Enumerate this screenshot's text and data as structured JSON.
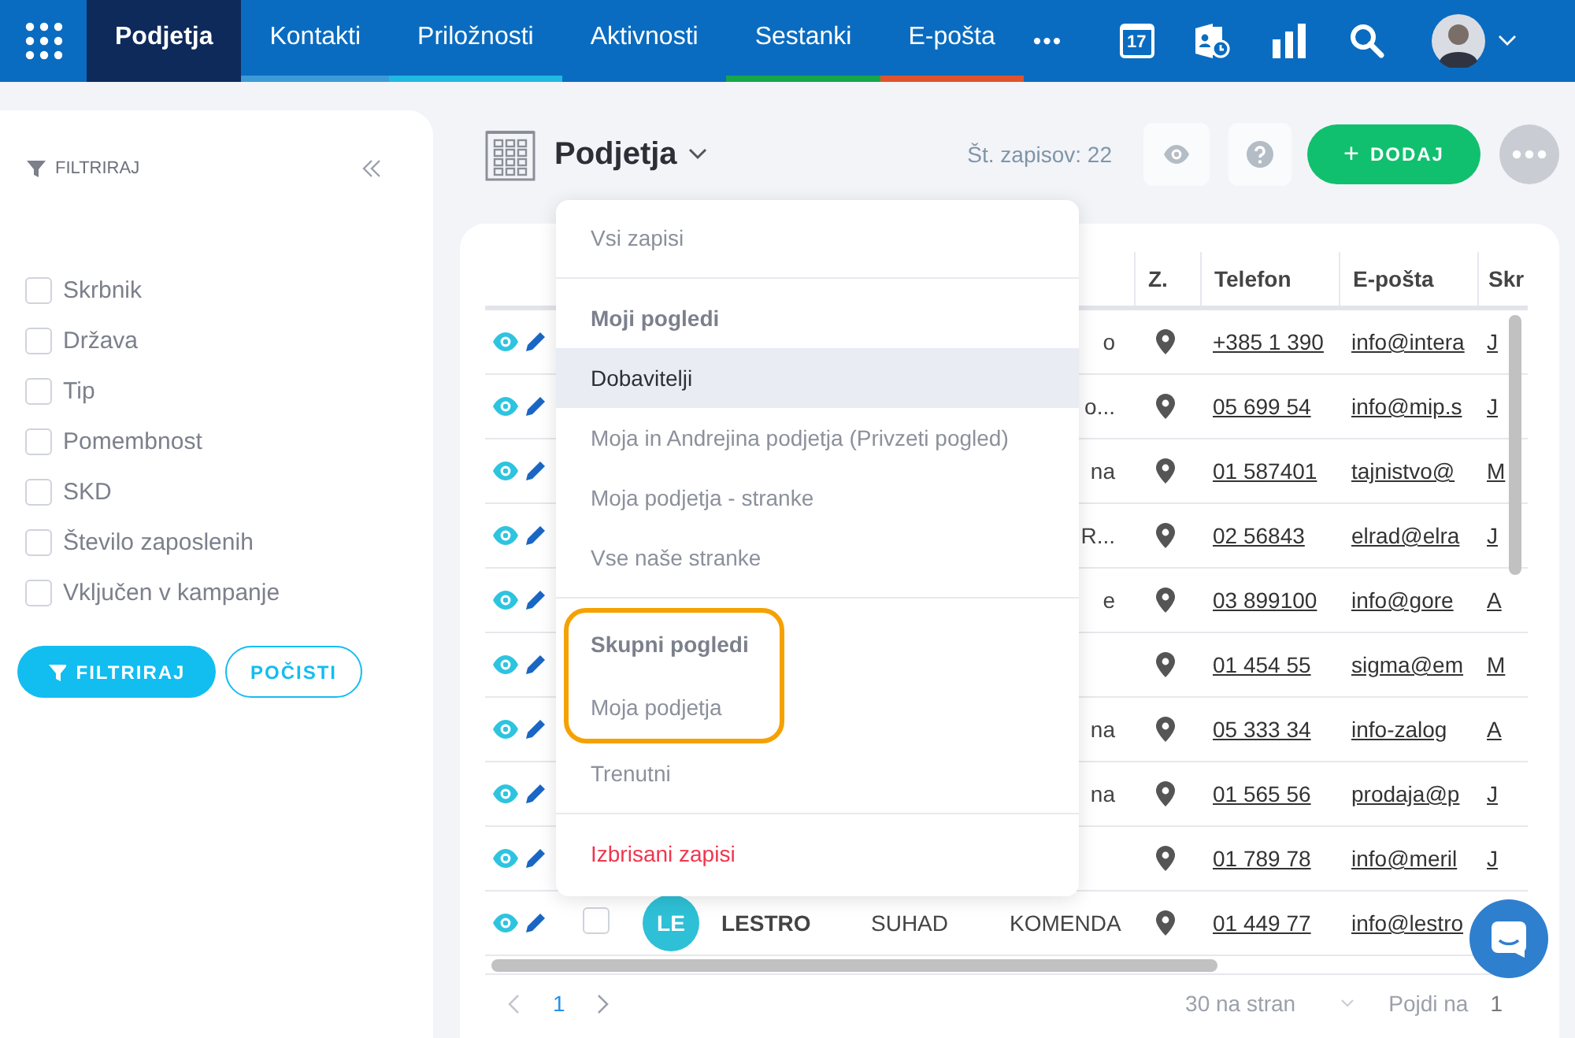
{
  "topbar": {
    "tabs": [
      {
        "label": "Podjetja",
        "selected": true
      },
      {
        "label": "Kontakti",
        "selected": false,
        "color": "#3d9ad8"
      },
      {
        "label": "Priložnosti",
        "selected": false,
        "color": "#20b9e2"
      },
      {
        "label": "Aktivnosti",
        "selected": false
      },
      {
        "label": "Sestanki",
        "selected": false,
        "color": "#16a64b"
      },
      {
        "label": "E-pošta",
        "selected": false,
        "color": "#e0532d"
      }
    ],
    "more": "•••",
    "calendar_day": "17"
  },
  "filter_panel": {
    "title": "FILTRIRAJ",
    "fields": [
      {
        "label": "Skrbnik",
        "checked": false
      },
      {
        "label": "Država",
        "checked": false
      },
      {
        "label": "Tip",
        "checked": false
      },
      {
        "label": "Pomembnost",
        "checked": false
      },
      {
        "label": "SKD",
        "checked": false
      },
      {
        "label": "Število zaposlenih",
        "checked": false
      },
      {
        "label": "Vključen v kampanje",
        "checked": false
      }
    ],
    "buttons": [
      {
        "label": "FILTRIRAJ",
        "kind": "primary"
      },
      {
        "label": "POČISTI",
        "kind": "outline"
      }
    ]
  },
  "header": {
    "title": "Podjetja",
    "record_count": "Št. zapisov: 22",
    "add_icon": "+",
    "add_button": "DODAJ"
  },
  "views_menu": {
    "items": [
      {
        "kind": "item",
        "label": "Vsi zapisi",
        "selected": false,
        "outlined": false
      },
      {
        "kind": "divider"
      },
      {
        "kind": "heading",
        "label": "Moji pogledi",
        "outlined": false
      },
      {
        "kind": "item",
        "label": "Dobavitelji",
        "selected": true,
        "outlined": false
      },
      {
        "kind": "item",
        "label": "Moja in Andrejina podjetja (Privzeti pogled)",
        "selected": false,
        "outlined": false
      },
      {
        "kind": "item",
        "label": "Moja podjetja - stranke",
        "selected": false,
        "outlined": false
      },
      {
        "kind": "item",
        "label": "Vse naše stranke",
        "selected": false,
        "outlined": false
      },
      {
        "kind": "divider"
      },
      {
        "kind": "heading",
        "label": "Skupni pogledi",
        "outlined": true
      },
      {
        "kind": "item",
        "label": "Moja podjetja",
        "selected": false,
        "outlined": true
      },
      {
        "kind": "item",
        "label": "Trenutni",
        "selected": false,
        "outlined": false
      },
      {
        "kind": "divider"
      },
      {
        "kind": "danger",
        "label": "Izbrisani zapisi",
        "selected": false,
        "outlined": false
      }
    ]
  },
  "table": {
    "columns": [
      {
        "label": "Z."
      },
      {
        "label": "Telefon"
      },
      {
        "label": "E-pošta"
      },
      {
        "label": "Skr"
      }
    ],
    "rows": [
      {
        "column_3": "o",
        "phone": "+385 1 390",
        "email": "info@intera",
        "owner": "J"
      },
      {
        "column_3": "o...",
        "phone": "05 699 54",
        "email": "info@mip.s",
        "owner": "J"
      },
      {
        "column_3": "na",
        "phone": "01 587401",
        "email": "tajnistvo@",
        "owner": "M"
      },
      {
        "column_3": "R...",
        "phone": "02 56843",
        "email": "elrad@elra",
        "owner": "J"
      },
      {
        "column_3": "e",
        "phone": "03 899100",
        "email": "info@gore",
        "owner": "A"
      },
      {
        "phone": "01 454 55",
        "email": "sigma@em",
        "owner": "M"
      },
      {
        "column_3": "na",
        "phone": "05 333 34",
        "email": "info-zalog",
        "owner": "A"
      },
      {
        "column_3": "na",
        "phone": "01 565 56",
        "email": "prodaja@p",
        "owner": "J"
      },
      {
        "phone": "01 789 78",
        "email": "info@meril",
        "owner": "J"
      },
      {
        "checked": false,
        "initials": "LE",
        "color": "#2ec0d6",
        "name": "LESTRO",
        "column_2": "SUHAD",
        "column_3": "KOMENDA",
        "phone": "01 449 77",
        "email": "info@lestro"
      }
    ]
  },
  "pagination": {
    "page": "1",
    "page_size": "30 na stran",
    "goto_label": "Pojdi na",
    "goto_value": "1"
  }
}
